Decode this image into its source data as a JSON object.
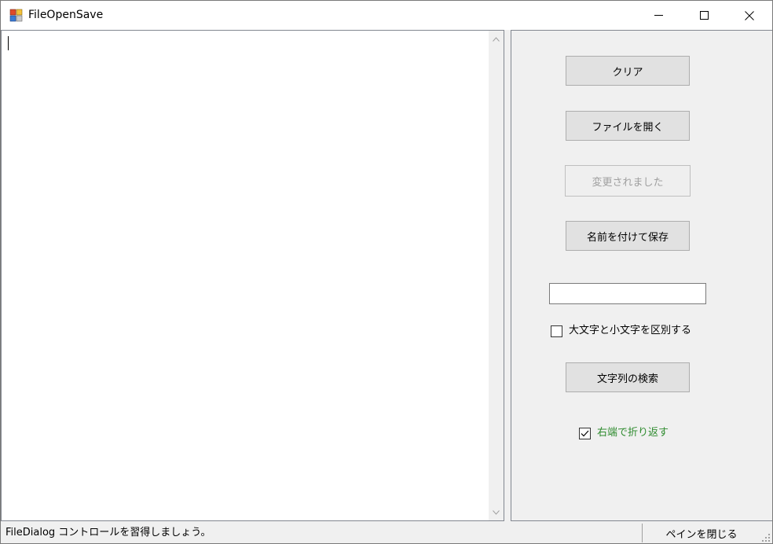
{
  "window": {
    "title": "FileOpenSave"
  },
  "buttons": {
    "clear": "クリア",
    "open_file": "ファイルを開く",
    "changed": "変更されました",
    "save_as": "名前を付けて保存",
    "search": "文字列の検索"
  },
  "search": {
    "value": ""
  },
  "checkboxes": {
    "case_sensitive": {
      "label": "大文字と小文字を区別する",
      "checked": false
    },
    "word_wrap": {
      "label": "右端で折り返す",
      "checked": true
    }
  },
  "statusbar": {
    "message": "FileDialog コントロールを習得しましょう。",
    "close_pane": "ペインを閉じる"
  },
  "colors": {
    "word_wrap_label": "#2e8b2e",
    "disabled_text": "#a0a0a0"
  }
}
